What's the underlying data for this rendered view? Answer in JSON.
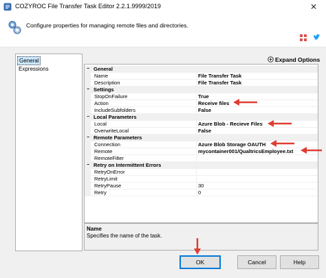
{
  "window": {
    "title": "COZYROC File Transfer Task Editor 2.2.1.9999/2019",
    "close_glyph": "✕"
  },
  "header": {
    "description": "Configure properties for managing remote files and directories."
  },
  "nav": {
    "items": [
      {
        "label": "General",
        "selected": true
      },
      {
        "label": "Expressions",
        "selected": false
      }
    ]
  },
  "toolbar": {
    "expand_label": "Expand Options"
  },
  "grid": {
    "categories": [
      {
        "label": "General",
        "toggle": "−",
        "rows": [
          {
            "name": "Name",
            "value": "File Transfer Task",
            "bold": true
          },
          {
            "name": "Description",
            "value": "File Transfer Task",
            "bold": true
          }
        ]
      },
      {
        "label": "Settings",
        "toggle": "−",
        "rows": [
          {
            "name": "StopOnFailure",
            "value": "True",
            "bold": true
          },
          {
            "name": "Action",
            "value": "Receive files",
            "bold": true
          },
          {
            "name": "IncludeSubfolders",
            "value": "False",
            "bold": true
          }
        ]
      },
      {
        "label": "Local Parameters",
        "toggle": "−",
        "rows": [
          {
            "name": "Local",
            "value": "Azure Blob - Recieve Files",
            "bold": true
          },
          {
            "name": "OverwriteLocal",
            "value": "False",
            "bold": true
          }
        ]
      },
      {
        "label": "Remote Parameters",
        "toggle": "−",
        "rows": [
          {
            "name": "Connection",
            "value": "Azure Blob Storage OAUTH",
            "bold": true
          },
          {
            "name": "Remote",
            "value": "mycontainer001/QualtricsEmployee.txt",
            "bold": true
          },
          {
            "name": "RemoteFilter",
            "value": "",
            "bold": false
          }
        ]
      },
      {
        "label": "Retry on Intermittent Errors",
        "toggle": "−",
        "rows": [
          {
            "name": "RetryOnError",
            "value": "",
            "bold": false
          },
          {
            "name": "RetryLimit",
            "value": "",
            "bold": false
          },
          {
            "name": "RetryPause",
            "value": "30",
            "bold": false
          },
          {
            "name": "Retry",
            "value": "0",
            "bold": false
          }
        ]
      }
    ]
  },
  "description_panel": {
    "title": "Name",
    "text": "Specifies the name of the task."
  },
  "buttons": {
    "ok": "OK",
    "cancel": "Cancel",
    "help": "Help"
  },
  "colors": {
    "annotation_arrow": "#e03c31",
    "selection": "#cce8ff",
    "default_button_border": "#0078d7"
  }
}
